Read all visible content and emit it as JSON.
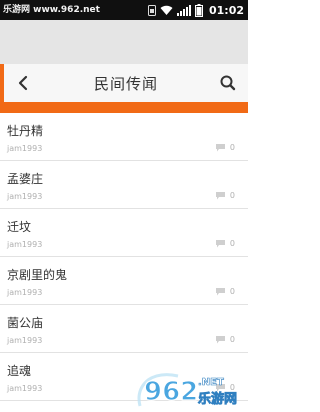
{
  "status_bar": {
    "left_text": "乐游网 www.962.net",
    "time": "01:02"
  },
  "header": {
    "title": "民间传闻",
    "back_icon": "chevron-left-icon",
    "search_icon": "search-icon"
  },
  "list": {
    "items": [
      {
        "title": "牡丹精",
        "author": "jam1993",
        "comments": "0"
      },
      {
        "title": "孟婆庄",
        "author": "jam1993",
        "comments": "0"
      },
      {
        "title": "迁坟",
        "author": "jam1993",
        "comments": "0"
      },
      {
        "title": "京剧里的鬼",
        "author": "jam1993",
        "comments": "0"
      },
      {
        "title": "菌公庙",
        "author": "jam1993",
        "comments": "0"
      },
      {
        "title": "追魂",
        "author": "jam1993",
        "comments": "0"
      }
    ]
  },
  "watermark": {
    "logo_text": "962",
    "domain": ".NET",
    "brand": "乐游网"
  },
  "colors": {
    "accent": "#f16a16",
    "status_bar": "#101010",
    "gray_band": "#e5e5e5"
  }
}
